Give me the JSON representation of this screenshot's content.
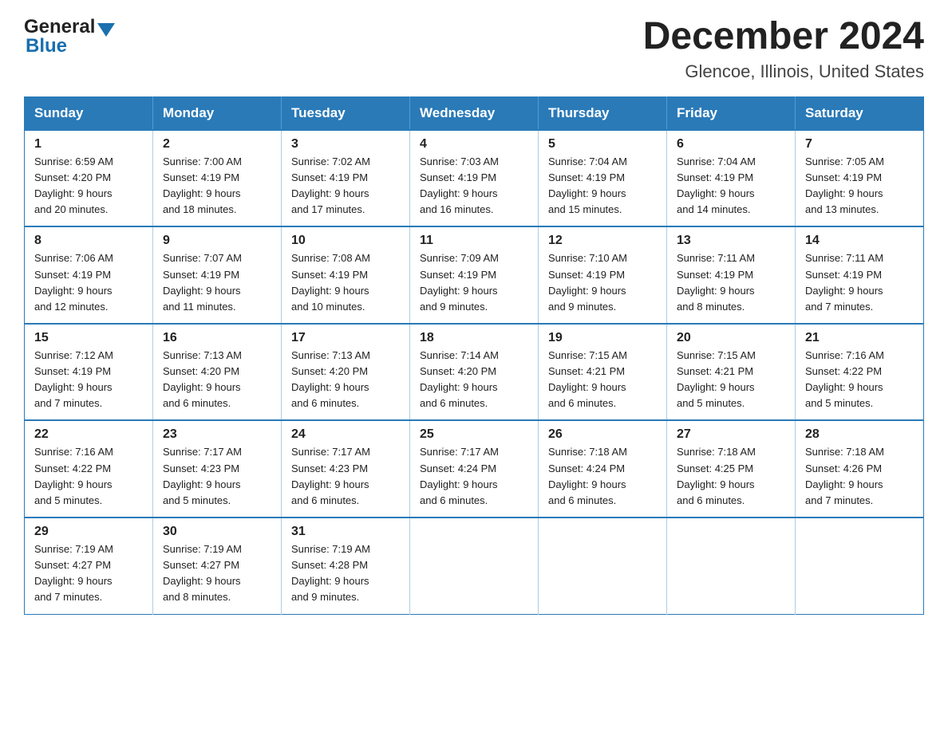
{
  "header": {
    "logo_line1": "General",
    "logo_arrow": "▶",
    "logo_line2": "Blue",
    "title": "December 2024",
    "subtitle": "Glencoe, Illinois, United States"
  },
  "calendar": {
    "days_of_week": [
      "Sunday",
      "Monday",
      "Tuesday",
      "Wednesday",
      "Thursday",
      "Friday",
      "Saturday"
    ],
    "weeks": [
      [
        {
          "day": "1",
          "sunrise": "6:59 AM",
          "sunset": "4:20 PM",
          "daylight": "9 hours and 20 minutes."
        },
        {
          "day": "2",
          "sunrise": "7:00 AM",
          "sunset": "4:19 PM",
          "daylight": "9 hours and 18 minutes."
        },
        {
          "day": "3",
          "sunrise": "7:02 AM",
          "sunset": "4:19 PM",
          "daylight": "9 hours and 17 minutes."
        },
        {
          "day": "4",
          "sunrise": "7:03 AM",
          "sunset": "4:19 PM",
          "daylight": "9 hours and 16 minutes."
        },
        {
          "day": "5",
          "sunrise": "7:04 AM",
          "sunset": "4:19 PM",
          "daylight": "9 hours and 15 minutes."
        },
        {
          "day": "6",
          "sunrise": "7:04 AM",
          "sunset": "4:19 PM",
          "daylight": "9 hours and 14 minutes."
        },
        {
          "day": "7",
          "sunrise": "7:05 AM",
          "sunset": "4:19 PM",
          "daylight": "9 hours and 13 minutes."
        }
      ],
      [
        {
          "day": "8",
          "sunrise": "7:06 AM",
          "sunset": "4:19 PM",
          "daylight": "9 hours and 12 minutes."
        },
        {
          "day": "9",
          "sunrise": "7:07 AM",
          "sunset": "4:19 PM",
          "daylight": "9 hours and 11 minutes."
        },
        {
          "day": "10",
          "sunrise": "7:08 AM",
          "sunset": "4:19 PM",
          "daylight": "9 hours and 10 minutes."
        },
        {
          "day": "11",
          "sunrise": "7:09 AM",
          "sunset": "4:19 PM",
          "daylight": "9 hours and 9 minutes."
        },
        {
          "day": "12",
          "sunrise": "7:10 AM",
          "sunset": "4:19 PM",
          "daylight": "9 hours and 9 minutes."
        },
        {
          "day": "13",
          "sunrise": "7:11 AM",
          "sunset": "4:19 PM",
          "daylight": "9 hours and 8 minutes."
        },
        {
          "day": "14",
          "sunrise": "7:11 AM",
          "sunset": "4:19 PM",
          "daylight": "9 hours and 7 minutes."
        }
      ],
      [
        {
          "day": "15",
          "sunrise": "7:12 AM",
          "sunset": "4:19 PM",
          "daylight": "9 hours and 7 minutes."
        },
        {
          "day": "16",
          "sunrise": "7:13 AM",
          "sunset": "4:20 PM",
          "daylight": "9 hours and 6 minutes."
        },
        {
          "day": "17",
          "sunrise": "7:13 AM",
          "sunset": "4:20 PM",
          "daylight": "9 hours and 6 minutes."
        },
        {
          "day": "18",
          "sunrise": "7:14 AM",
          "sunset": "4:20 PM",
          "daylight": "9 hours and 6 minutes."
        },
        {
          "day": "19",
          "sunrise": "7:15 AM",
          "sunset": "4:21 PM",
          "daylight": "9 hours and 6 minutes."
        },
        {
          "day": "20",
          "sunrise": "7:15 AM",
          "sunset": "4:21 PM",
          "daylight": "9 hours and 5 minutes."
        },
        {
          "day": "21",
          "sunrise": "7:16 AM",
          "sunset": "4:22 PM",
          "daylight": "9 hours and 5 minutes."
        }
      ],
      [
        {
          "day": "22",
          "sunrise": "7:16 AM",
          "sunset": "4:22 PM",
          "daylight": "9 hours and 5 minutes."
        },
        {
          "day": "23",
          "sunrise": "7:17 AM",
          "sunset": "4:23 PM",
          "daylight": "9 hours and 5 minutes."
        },
        {
          "day": "24",
          "sunrise": "7:17 AM",
          "sunset": "4:23 PM",
          "daylight": "9 hours and 6 minutes."
        },
        {
          "day": "25",
          "sunrise": "7:17 AM",
          "sunset": "4:24 PM",
          "daylight": "9 hours and 6 minutes."
        },
        {
          "day": "26",
          "sunrise": "7:18 AM",
          "sunset": "4:24 PM",
          "daylight": "9 hours and 6 minutes."
        },
        {
          "day": "27",
          "sunrise": "7:18 AM",
          "sunset": "4:25 PM",
          "daylight": "9 hours and 6 minutes."
        },
        {
          "day": "28",
          "sunrise": "7:18 AM",
          "sunset": "4:26 PM",
          "daylight": "9 hours and 7 minutes."
        }
      ],
      [
        {
          "day": "29",
          "sunrise": "7:19 AM",
          "sunset": "4:27 PM",
          "daylight": "9 hours and 7 minutes."
        },
        {
          "day": "30",
          "sunrise": "7:19 AM",
          "sunset": "4:27 PM",
          "daylight": "9 hours and 8 minutes."
        },
        {
          "day": "31",
          "sunrise": "7:19 AM",
          "sunset": "4:28 PM",
          "daylight": "9 hours and 9 minutes."
        },
        null,
        null,
        null,
        null
      ]
    ],
    "sunrise_label": "Sunrise:",
    "sunset_label": "Sunset:",
    "daylight_label": "Daylight:"
  }
}
